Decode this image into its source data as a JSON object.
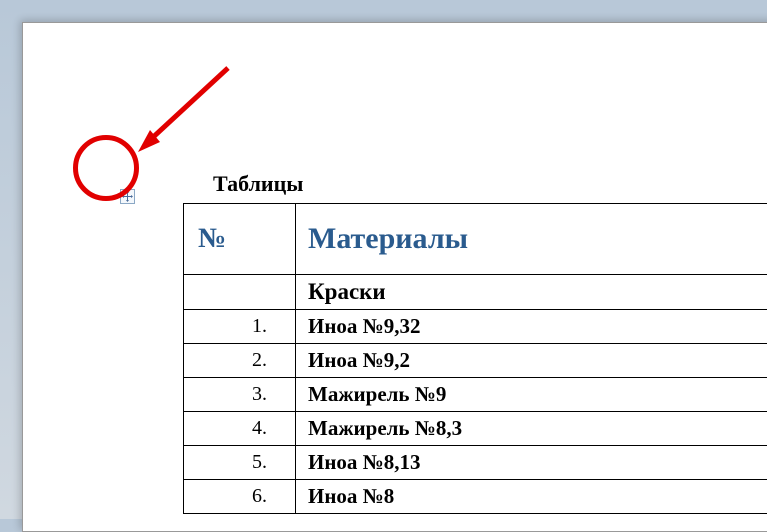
{
  "title": "Таблицы",
  "table": {
    "headers": {
      "num": "№",
      "mat": "Материалы"
    },
    "group_label": "Краски",
    "rows": [
      {
        "n": "1.",
        "m": "Иноа №9,32"
      },
      {
        "n": "2.",
        "m": "Иноа №9,2"
      },
      {
        "n": "3.",
        "m": "Мажирель №9"
      },
      {
        "n": "4.",
        "m": "Мажирель №8,3"
      },
      {
        "n": "5.",
        "m": "Иноа №8,13"
      },
      {
        "n": "6.",
        "m": "Иноа №8"
      }
    ]
  }
}
